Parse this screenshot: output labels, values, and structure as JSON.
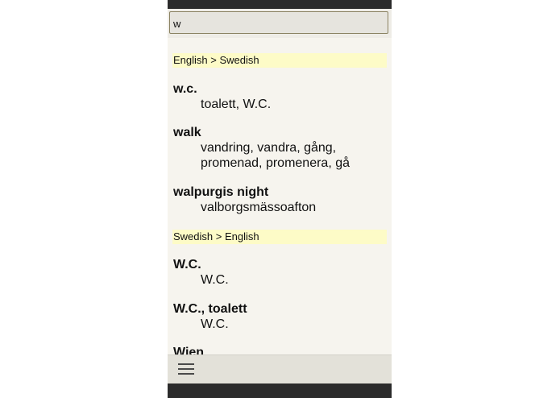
{
  "search": {
    "value": "w",
    "placeholder": ""
  },
  "sections": [
    {
      "header": "English > Swedish",
      "entries": [
        {
          "headword": "w.c.",
          "translation": [
            "toalett, W.C."
          ]
        },
        {
          "headword": "walk",
          "translation": [
            "vandring, vandra, gång,",
            "promenad, promenera, gå"
          ]
        },
        {
          "headword": "walpurgis night",
          "translation": [
            "valborgsmässoafton"
          ]
        }
      ]
    },
    {
      "header": "Swedish > English",
      "entries": [
        {
          "headword": "W.C.",
          "translation": [
            "W.C."
          ]
        },
        {
          "headword": "W.C., toalett",
          "translation": [
            "W.C."
          ]
        },
        {
          "headword": "Wien",
          "translation": []
        }
      ]
    }
  ],
  "bottom_bar": {
    "menu_icon": "hamburger-menu-icon"
  },
  "colors": {
    "section_header_bg": "#fdfbc7",
    "background": "#f6f4ee",
    "system_bar": "#2b2b2b"
  }
}
